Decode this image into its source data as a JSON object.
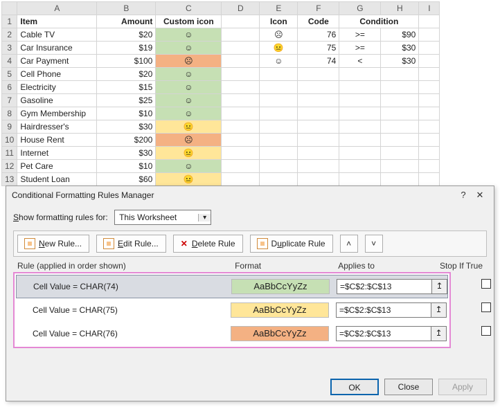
{
  "sheet": {
    "cols": [
      "",
      "A",
      "B",
      "C",
      "D",
      "E",
      "F",
      "G",
      "H",
      "I"
    ],
    "widths": [
      22,
      115,
      85,
      95,
      55,
      55,
      60,
      60,
      55,
      30
    ],
    "header_row": {
      "A": "Item",
      "B": "Amount",
      "C": "Custom icon",
      "E": "Icon",
      "F": "Code",
      "G": "Condition",
      "H": ""
    },
    "rows": [
      {
        "n": 2,
        "A": "Cable TV",
        "B": "$20",
        "C": "☺",
        "cc": "grn",
        "E": "☹",
        "F": "76",
        "G": ">=",
        "H": "$90"
      },
      {
        "n": 3,
        "A": "Car Insurance",
        "B": "$19",
        "C": "☺",
        "cc": "grn",
        "E": "😐",
        "F": "75",
        "G": ">=",
        "H": "$30"
      },
      {
        "n": 4,
        "A": "Car Payment",
        "B": "$100",
        "C": "☹",
        "cc": "org",
        "E": "☺",
        "F": "74",
        "G": "<",
        "H": "$30"
      },
      {
        "n": 5,
        "A": "Cell Phone",
        "B": "$20",
        "C": "☺",
        "cc": "grn"
      },
      {
        "n": 6,
        "A": "Electricity",
        "B": "$15",
        "C": "☺",
        "cc": "grn"
      },
      {
        "n": 7,
        "A": "Gasoline",
        "B": "$25",
        "C": "☺",
        "cc": "grn"
      },
      {
        "n": 8,
        "A": "Gym Membership",
        "B": "$10",
        "C": "☺",
        "cc": "grn"
      },
      {
        "n": 9,
        "A": "Hairdresser's",
        "B": "$30",
        "C": "😐",
        "cc": "yel"
      },
      {
        "n": 10,
        "A": "House Rent",
        "B": "$200",
        "C": "☹",
        "cc": "org"
      },
      {
        "n": 11,
        "A": "Internet",
        "B": "$30",
        "C": "😐",
        "cc": "yel"
      },
      {
        "n": 12,
        "A": "Pet Care",
        "B": "$10",
        "C": "☺",
        "cc": "grn"
      },
      {
        "n": 13,
        "A": "Student Loan",
        "B": "$60",
        "C": "😐",
        "cc": "yel"
      }
    ]
  },
  "dialog": {
    "title": "Conditional Formatting Rules Manager",
    "help": "?",
    "close": "✕",
    "show_label": "Show formatting rules for:",
    "show_value": "This Worksheet",
    "toolbar": {
      "new": "New Rule...",
      "edit": "Edit Rule...",
      "delete": "Delete Rule",
      "duplicate": "Duplicate Rule",
      "up": "˄",
      "down": "˅"
    },
    "cols": {
      "rule": "Rule (applied in order shown)",
      "format": "Format",
      "applies": "Applies to",
      "stop": "Stop If True"
    },
    "sample": "AaBbCcYyZz",
    "rules": [
      {
        "text": "Cell Value = CHAR(74)",
        "color": "grn",
        "ref": "=$C$2:$C$13",
        "sel": true
      },
      {
        "text": "Cell Value = CHAR(75)",
        "color": "yel",
        "ref": "=$C$2:$C$13"
      },
      {
        "text": "Cell Value = CHAR(76)",
        "color": "org",
        "ref": "=$C$2:$C$13"
      }
    ],
    "buttons": {
      "ok": "OK",
      "close": "Close",
      "apply": "Apply"
    }
  }
}
